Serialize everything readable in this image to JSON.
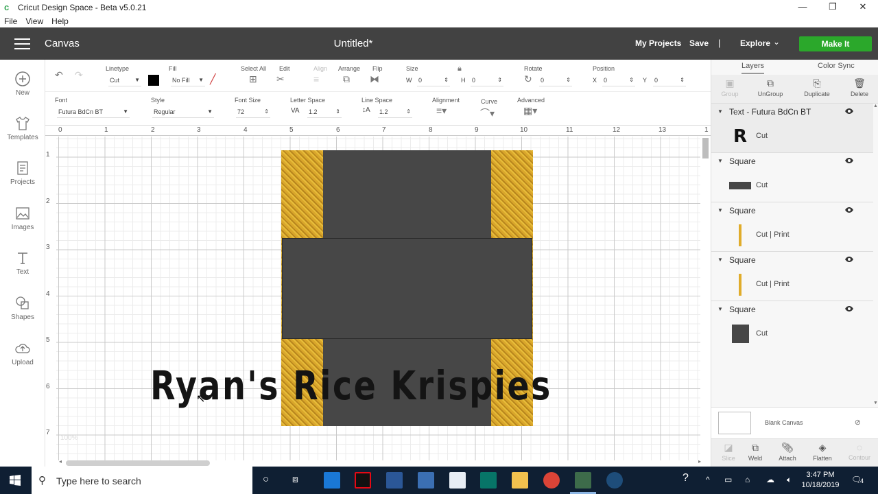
{
  "window": {
    "title": "Cricut Design Space - Beta v5.0.21",
    "minimize": "—",
    "restore": "❐",
    "close": "✕"
  },
  "menu": {
    "items": [
      "File",
      "View",
      "Help"
    ]
  },
  "header": {
    "section": "Canvas",
    "doc_title": "Untitled*",
    "my_projects": "My Projects",
    "save": "Save",
    "separator": "|",
    "explore": "Explore",
    "make_it": "Make It",
    "accent_color": "#2ba82b"
  },
  "sidebar": {
    "items": [
      {
        "label": "New",
        "icon": "plus-circle-icon"
      },
      {
        "label": "Templates",
        "icon": "tshirt-icon"
      },
      {
        "label": "Projects",
        "icon": "projects-icon"
      },
      {
        "label": "Images",
        "icon": "image-icon"
      },
      {
        "label": "Text",
        "icon": "text-icon"
      },
      {
        "label": "Shapes",
        "icon": "shapes-icon"
      },
      {
        "label": "Upload",
        "icon": "cloud-upload-icon"
      }
    ]
  },
  "toolbar": {
    "linetype_label": "Linetype",
    "linetype_value": "Cut",
    "fill_label": "Fill",
    "fill_value": "No Fill",
    "select_all": "Select All",
    "edit": "Edit",
    "align": "Align",
    "arrange": "Arrange",
    "flip": "Flip",
    "size": "Size",
    "w_label": "W",
    "w_value": "0",
    "h_label": "H",
    "h_value": "0",
    "rotate": "Rotate",
    "rotate_value": "0",
    "position": "Position",
    "x_label": "X",
    "x_value": "0",
    "y_label": "Y",
    "y_value": "0"
  },
  "text_toolbar": {
    "font_label": "Font",
    "font_value": "Futura BdCn BT",
    "style_label": "Style",
    "style_value": "Regular",
    "font_size_label": "Font Size",
    "font_size_value": "72",
    "letter_space_label": "Letter Space",
    "letter_space_value": "1.2",
    "line_space_label": "Line Space",
    "line_space_value": "1.2",
    "alignment_label": "Alignment",
    "curve_label": "Curve",
    "advanced_label": "Advanced"
  },
  "ruler": {
    "top": [
      "0",
      "1",
      "2",
      "3",
      "4",
      "5",
      "6",
      "7",
      "8",
      "9",
      "10",
      "11",
      "12",
      "13",
      "1"
    ],
    "left": [
      "1",
      "2",
      "3",
      "4",
      "5",
      "6",
      "7"
    ]
  },
  "canvas": {
    "design_text": "Ryan's Rice Krispies",
    "zoom": "100%"
  },
  "layers_panel": {
    "tab_layers": "Layers",
    "tab_color_sync": "Color Sync",
    "actions": [
      "Group",
      "UnGroup",
      "Duplicate",
      "Delete"
    ],
    "groups": [
      {
        "name": "Text - Futura BdCn BT",
        "thumb_text": "R",
        "operation": "Cut",
        "thumb_color": "#111111"
      },
      {
        "name": "Square",
        "operation": "Cut",
        "thumb_color": "#474747"
      },
      {
        "name": "Square",
        "operation": "Cut  |  Print",
        "thumb_color": "#e0ac2b"
      },
      {
        "name": "Square",
        "operation": "Cut  |  Print",
        "thumb_color": "#e0ac2b"
      },
      {
        "name": "Square",
        "operation": "Cut",
        "thumb_color": "#474747"
      }
    ],
    "blank_canvas": "Blank Canvas",
    "bottom_actions": [
      "Slice",
      "Weld",
      "Attach",
      "Flatten",
      "Contour"
    ]
  },
  "taskbar": {
    "search_placeholder": "Type here to search",
    "time": "3:47 PM",
    "date": "10/18/2019",
    "notifications": "4"
  }
}
